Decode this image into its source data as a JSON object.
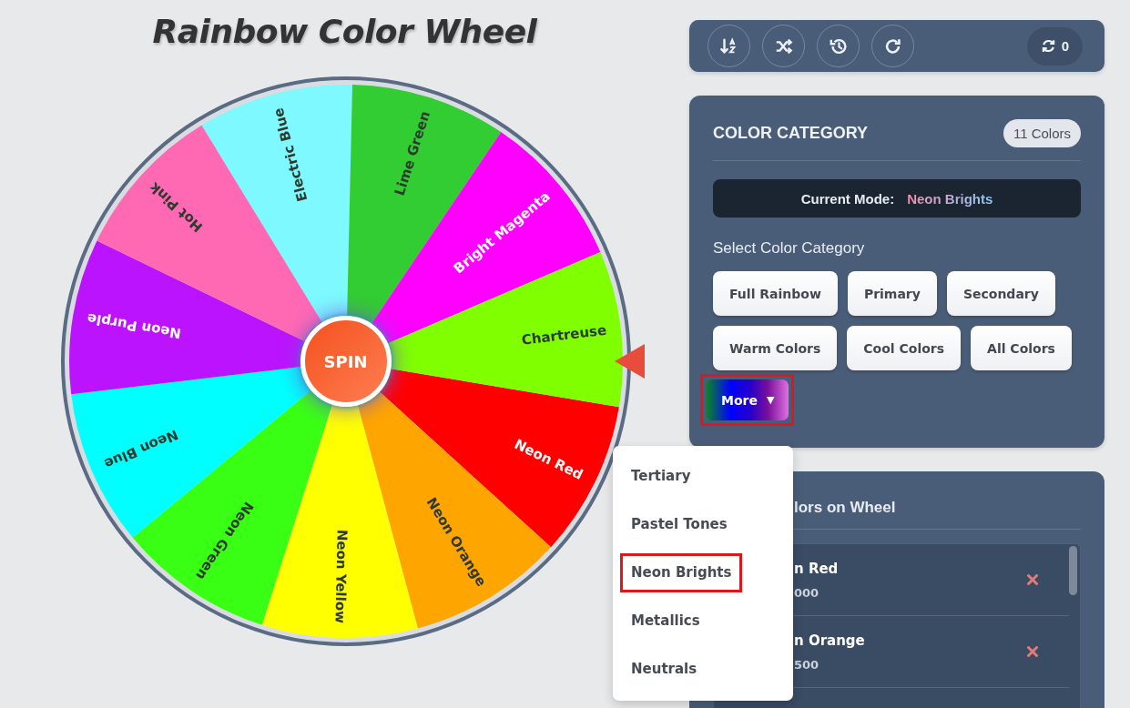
{
  "title": "Rainbow Color Wheel",
  "wheel": {
    "spin_label": "SPIN",
    "segments": [
      {
        "label": "Neon Red",
        "color": "#ff0000"
      },
      {
        "label": "Neon Orange",
        "color": "#ffa500"
      },
      {
        "label": "Neon Yellow",
        "color": "#ffff00"
      },
      {
        "label": "Neon Green",
        "color": "#39ff14"
      },
      {
        "label": "Neon Blue",
        "color": "#00ffff"
      },
      {
        "label": "Neon Purple",
        "color": "#bc13fe"
      },
      {
        "label": "Hot Pink",
        "color": "#ff69b4"
      },
      {
        "label": "Electric Blue",
        "color": "#7df9ff"
      },
      {
        "label": "Lime Green",
        "color": "#32cd32"
      },
      {
        "label": "Bright Magenta",
        "color": "#ff00ff"
      },
      {
        "label": "Chartreuse",
        "color": "#7fff00"
      }
    ]
  },
  "toolbar": {
    "buttons": [
      {
        "kind": "sort"
      },
      {
        "kind": "shuffle"
      },
      {
        "kind": "history"
      },
      {
        "kind": "redo"
      }
    ],
    "spin_count": "0"
  },
  "category_panel": {
    "heading": "COLOR CATEGORY",
    "count_badge": "11 Colors",
    "mode_label": "Current Mode:",
    "mode_value": "Neon Brights",
    "select_label": "Select Color Category",
    "categories": [
      {
        "label": "Full Rainbow",
        "selected": false
      },
      {
        "label": "Primary",
        "selected": false
      },
      {
        "label": "Secondary",
        "selected": false
      },
      {
        "label": "Warm Colors",
        "selected": false
      },
      {
        "label": "Cool Colors",
        "selected": false
      },
      {
        "label": "All Colors",
        "selected": false
      }
    ],
    "more_button": {
      "label": "More",
      "caret": "▼",
      "highlighted": true
    }
  },
  "more_menu": {
    "items": [
      {
        "label": "Tertiary",
        "highlighted": false
      },
      {
        "label": "Pastel Tones",
        "highlighted": false
      },
      {
        "label": "Neon Brights",
        "highlighted": true
      },
      {
        "label": "Metallics",
        "highlighted": false
      },
      {
        "label": "Neutrals",
        "highlighted": false
      }
    ]
  },
  "colors_panel": {
    "heading": "lors on Wheel",
    "items": [
      {
        "name": "n Red",
        "code": "000"
      },
      {
        "name": "n Orange",
        "code": "500"
      }
    ]
  }
}
